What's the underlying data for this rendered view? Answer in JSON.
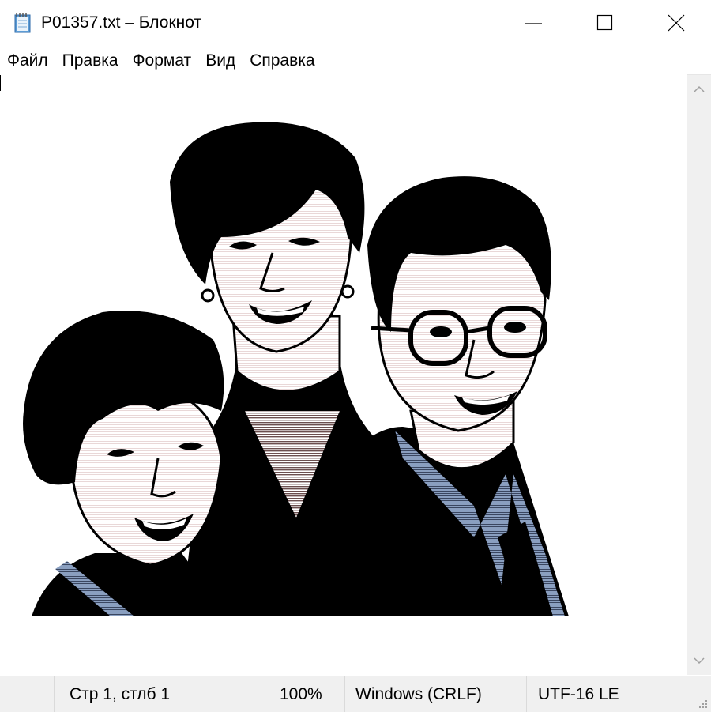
{
  "window": {
    "title": "P01357.txt – Блокнот",
    "controls": [
      "minimize-icon",
      "maximize-icon",
      "close-icon"
    ]
  },
  "menu": {
    "items": [
      "Файл",
      "Правка",
      "Формат",
      "Вид",
      "Справка"
    ]
  },
  "editor": {
    "content": "ASCII-art style illustration of three smiling people (a woman with short dark hair, a woman with earrings, and a man with glasses wearing a shirt and tie)"
  },
  "statusbar": {
    "position": "Стр 1, стлб 1",
    "zoom": "100%",
    "line_ending": "Windows (CRLF)",
    "encoding": "UTF-16 LE"
  },
  "colors": {
    "shirt_blue": "#8a9fc0",
    "sweater_stripe": "#8a6b6b",
    "chrome": "#f0f0f0"
  }
}
